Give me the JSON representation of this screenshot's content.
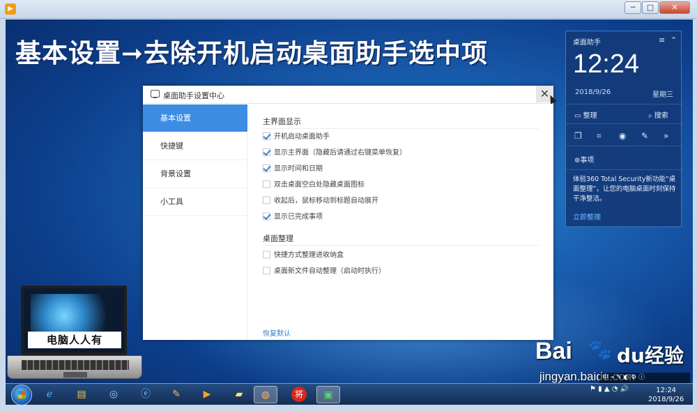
{
  "window": {
    "min_label": "─",
    "max_label": "□",
    "close_label": "✕"
  },
  "headline": "基本设置➞去除开机启动桌面助手选中项",
  "widget": {
    "title": "桌面助手",
    "menu_glyph": "≡",
    "collapse_glyph": "⌃",
    "time": "12:24",
    "date": "2018/9/26",
    "weekday": "星期三",
    "actions": {
      "organize": "整理",
      "search": "搜索",
      "add_task": "事项"
    },
    "message": "体验360 Total Security新功能“桌面整理”，让您的电脑桌面时刻保持干净整洁。",
    "link": "立即整理"
  },
  "dialog": {
    "title": "桌面助手设置中心",
    "close_label": "✕",
    "sidebar": [
      {
        "label": "基本设置",
        "active": true
      },
      {
        "label": "快捷键",
        "active": false
      },
      {
        "label": "背景设置",
        "active": false
      },
      {
        "label": "小工具",
        "active": false
      }
    ],
    "sections": {
      "main_display": {
        "title": "主界面显示",
        "options": [
          {
            "label": "开机启动桌面助手",
            "checked": true
          },
          {
            "label": "显示主界面（隐藏后请通过右键菜单恢复）",
            "checked": true
          },
          {
            "label": "显示时间和日期",
            "checked": true
          },
          {
            "label": "双击桌面空白处隐藏桌面图标",
            "checked": false
          },
          {
            "label": "收起后，鼠标移动到标题自动展开",
            "checked": false
          },
          {
            "label": "显示已完成事项",
            "checked": true
          }
        ]
      },
      "desktop_organize": {
        "title": "桌面整理",
        "options": [
          {
            "label": "快捷方式整理进收纳盒",
            "checked": false
          },
          {
            "label": "桌面新文件自动整理（启动时执行）",
            "checked": false
          }
        ]
      }
    },
    "restore_link": "恢复默认"
  },
  "laptop_label": "电脑人人有",
  "watermark": {
    "brand": "Bai",
    "brand2": "du",
    "jingyan": "经验",
    "url": "jingyan.baidu.com"
  },
  "taskbar": {
    "clock_time": "12:24",
    "clock_date": "2018/9/26",
    "pinned": [
      "ie-icon",
      "folder-icon",
      "network-icon",
      "ie2-icon",
      "paint-icon",
      "player-icon",
      "notes-icon",
      "app-icon",
      "chess-icon",
      "desktop-helper-icon"
    ]
  },
  "colors": {
    "accent": "#3d8de4",
    "desktop": "#1a5fb0",
    "widget_bg": "#143a78"
  }
}
